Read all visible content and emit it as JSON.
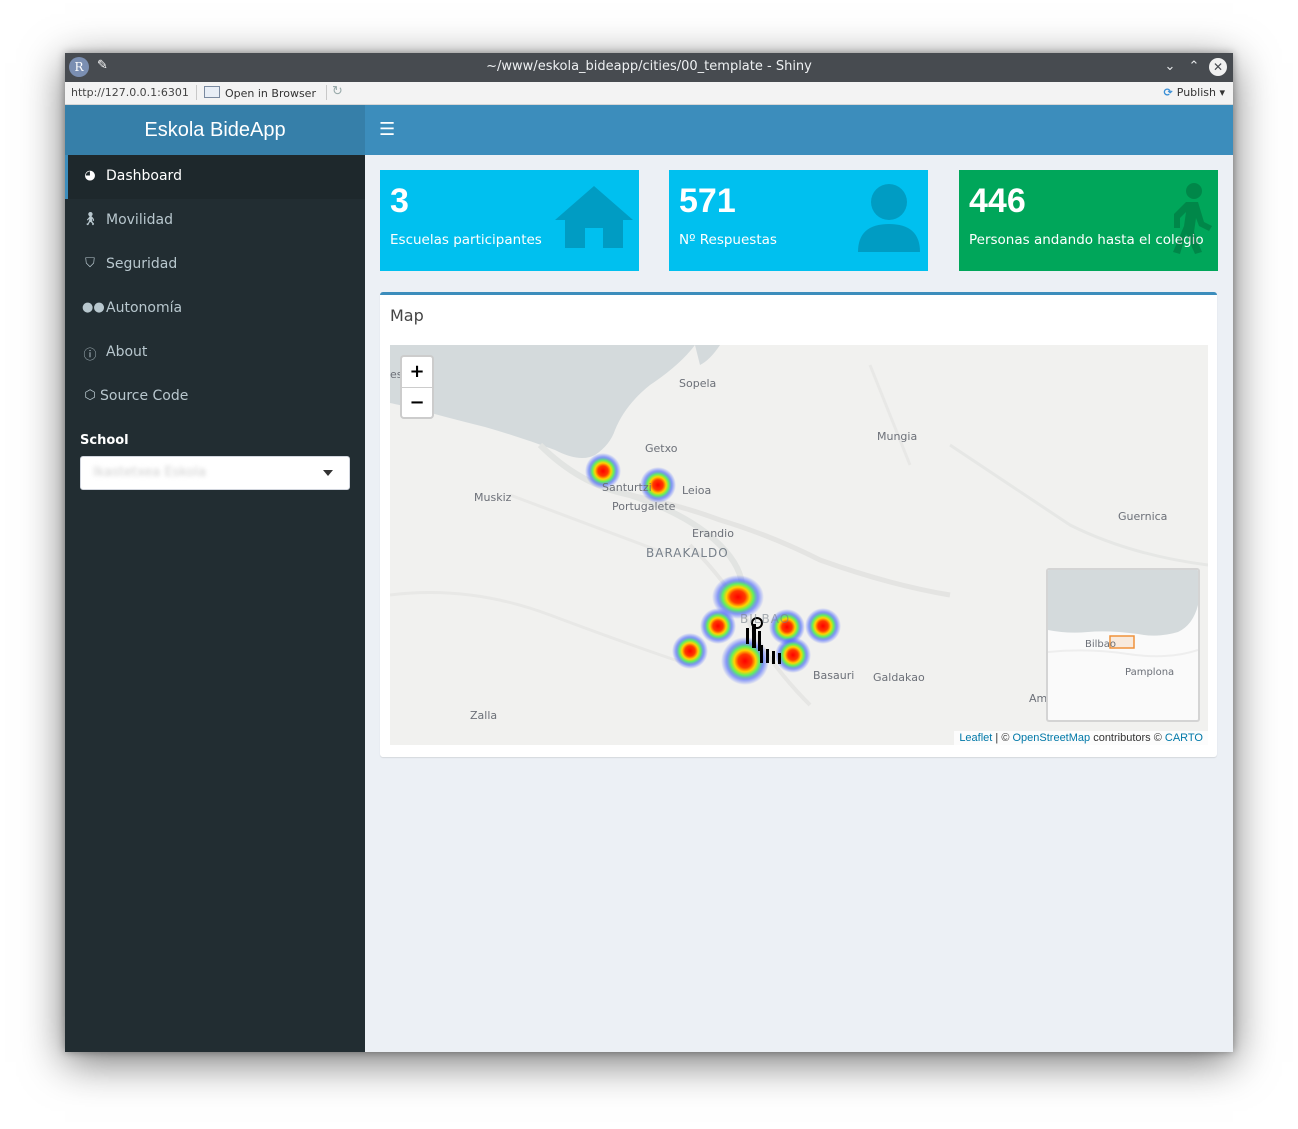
{
  "window": {
    "title": "~/www/eskola_bideapp/cities/00_template - Shiny",
    "url": "http://127.0.0.1:6301",
    "open_browser": "Open in Browser",
    "publish": "Publish"
  },
  "app": {
    "brand": "Eskola BideApp",
    "menu": [
      {
        "label": "Dashboard",
        "icon": "dashboard-icon"
      },
      {
        "label": "Movilidad",
        "icon": "walking-icon"
      },
      {
        "label": "Seguridad",
        "icon": "shield-icon"
      },
      {
        "label": "Autonomía",
        "icon": "users-icon"
      },
      {
        "label": "About",
        "icon": "info-icon"
      },
      {
        "label": "Source Code",
        "icon": "gitlab-icon"
      }
    ],
    "school_label": "School",
    "school_value": "Ikastetxea Eskola"
  },
  "value_boxes": [
    {
      "value": "3",
      "label": "Escuelas participantes",
      "icon": "home-icon",
      "color": "#00c0ef"
    },
    {
      "value": "571",
      "label": "Nº Respuestas",
      "icon": "user-icon",
      "color": "#00c0ef"
    },
    {
      "value": "446",
      "label": "Personas andando hasta el colegio",
      "icon": "walking-icon",
      "color": "#00a65a"
    }
  ],
  "map": {
    "title": "Map",
    "zoom_in": "+",
    "zoom_out": "−",
    "places": [
      "Sopela",
      "Getxo",
      "Mungia",
      "Muskiz",
      "Santurtzi",
      "Leioa",
      "Portugalete",
      "Erandio",
      "BARAKALDO",
      "Guernica",
      "Basauri",
      "Galdakao",
      "Zalla",
      "BILBAO",
      "Am",
      "es"
    ],
    "minimap_places": [
      "Bilbao",
      "Pamplona"
    ],
    "attribution": {
      "leaflet": "Leaflet",
      "sep1": " | © ",
      "osm": "OpenStreetMap",
      "mid": " contributors © ",
      "carto": "CARTO"
    }
  }
}
